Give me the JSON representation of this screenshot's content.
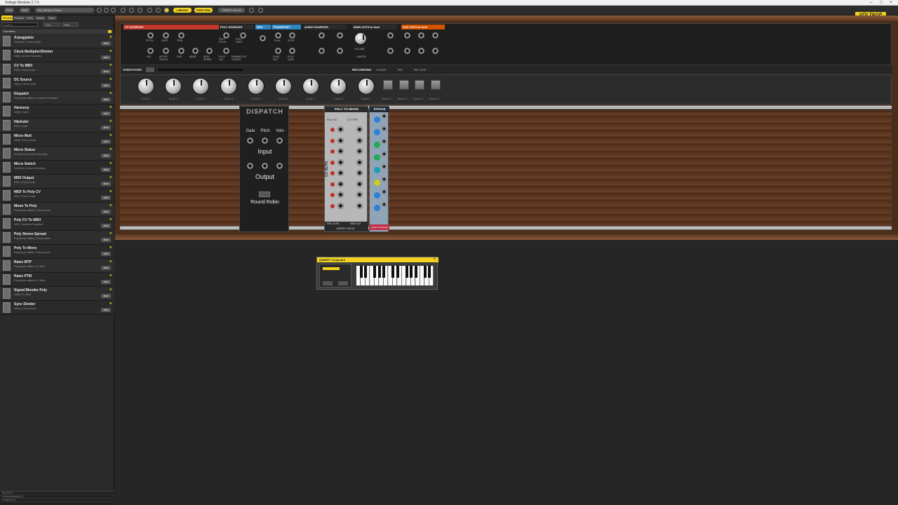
{
  "window": {
    "title": "Voltage Modular 2.7.6"
  },
  "toolbar": {
    "menu_labels": [
      "FILE",
      "EDIT"
    ],
    "preset": "VM_Default_Preset",
    "library": "LIBRARY",
    "perform": "PERFORM",
    "tempo": "TEMPO 120.00",
    "brand": "VOLTAGE"
  },
  "sidebar": {
    "tabs": [
      "Modules",
      "Presets",
      "VMS",
      "Banks",
      "Store"
    ],
    "search_placeholder": "Search",
    "sort": "Sort",
    "filter": "Filter",
    "favorites_header": "Favorites",
    "modules": [
      {
        "name": "Arpeggiator",
        "maker": "Controller | Cherry Audio"
      },
      {
        "name": "Clock Multiplier/Divider",
        "maker": "Utility | Andrew Macaulay"
      },
      {
        "name": "CV To MIDI",
        "maker": "MIDI | Cherry Audio"
      },
      {
        "name": "DC Source",
        "maker": "Utility | Cherry Audio"
      },
      {
        "name": "Dispatch",
        "maker": "Polyphonic utilities | Turbulent Propelant"
      },
      {
        "name": "Harmony",
        "maker": "Utility | Hawrt"
      },
      {
        "name": "Häcksler",
        "maker": "Effect | haxit"
      },
      {
        "name": "Micro Mult",
        "maker": "Utility | Cherry Audio"
      },
      {
        "name": "Micro Status",
        "maker": "Visualizers | Andrew Macaulay"
      },
      {
        "name": "Micro Switch",
        "maker": "Switches | Andrew Macaulay"
      },
      {
        "name": "MIDI Output",
        "maker": "MIDI | Cherry Audio"
      },
      {
        "name": "MIDI To Poly CV",
        "maker": "MIDI | Cherry Audio"
      },
      {
        "name": "Mono To Poly",
        "maker": "Polyphonic utilities | Cherry Audio"
      },
      {
        "name": "Poly CV To MIDI",
        "maker": "MIDI | Turbulent Propelant"
      },
      {
        "name": "Poly Stereo Spread",
        "maker": "Polyphonic utilities | Cherry Audio"
      },
      {
        "name": "Poly To Mono",
        "maker": "Polyphonic utilities | Cherry Audio"
      },
      {
        "name": "Rawx MTP",
        "maker": "Polyphonic utilities | R_Ware"
      },
      {
        "name": "Rawx PTM",
        "maker": "Polyphonic utilities | R_Ware"
      },
      {
        "name": "Signal Blender Poly",
        "maker": "Utility | R_Ware"
      },
      {
        "name": "Sync Divider",
        "maker": "Utility | Cherry Audio"
      }
    ],
    "add_label": "Add",
    "footer": [
      "All (1079)",
      "In Development (0)",
      "In Rack (47)"
    ]
  },
  "host": {
    "sections": [
      {
        "label": "CV SOURCES",
        "color": "#c0392b"
      },
      {
        "label": "POLY SOURCES",
        "color": "#2b2b2b"
      },
      {
        "label": "MIDI",
        "color": "#2e86c1"
      },
      {
        "label": "TRANSPORT",
        "color": "#2e86c1"
      },
      {
        "label": "AUDIO SOURCES",
        "color": "#2b2b2b"
      },
      {
        "label": "MAIN OUTS to host",
        "color": "#2b2b2b"
      },
      {
        "label": "AUX OUTS to host",
        "color": "#d35400"
      }
    ],
    "cv_labels": [
      "PITCH",
      "GATE",
      "TRIG",
      "VEL",
      "AFTER TOUCH",
      "SUS",
      "BEND",
      "MOD WHEEL"
    ],
    "poly_labels": [
      "POLY PITCH",
      "POLY GATE",
      "POLY VEL",
      "NUMBER OF VOICES"
    ],
    "transport_labels": [
      "PLAY",
      "STOP",
      "SYNC OUT",
      "PLAY GATE"
    ],
    "volume_label": "VOLUME",
    "limiter_label": "LIMITER",
    "variations_label": "VARIATIONS",
    "recording_label": "RECORDING",
    "folder_label": "FOLDER",
    "rec_label": "REC",
    "rec_gate_label": "REC GATE"
  },
  "perform_strip": {
    "knobs": [
      "Knob 1",
      "Knob 2",
      "Knob 3",
      "Knob 4",
      "Knob 5",
      "Knob 6",
      "Knob 7",
      "Knob 8",
      "Knob 9"
    ],
    "buttons": [
      "Button 1",
      "Button 2",
      "Button 3",
      "Button 4"
    ]
  },
  "dispatch": {
    "title": "DISPATCH",
    "cols": [
      "Gate",
      "Pitch",
      "Velo"
    ],
    "input": "Input",
    "output": "Output",
    "mode": "Round Robin"
  },
  "poly_to_mono": {
    "title": "POLY TO MONO",
    "side": "CV OUTS",
    "poly_in": "POLY IN",
    "cv_type": "CV TYPE",
    "mix_level": "MIX LEVEL",
    "midi_out": "MIDI OUT",
    "maker": "CHERRY AUDIO"
  },
  "status": {
    "title": "STATUS",
    "maker": "Andrew Macaulay",
    "led_colors": [
      "#2f7fd6",
      "#2f7fd6",
      "#22aa55",
      "#22aa55",
      "#1d9fb2",
      "#d4c81a",
      "#2f7fd6",
      "#2f7fd6"
    ]
  },
  "qwerty": {
    "title": "QWERTY Keyboard"
  }
}
